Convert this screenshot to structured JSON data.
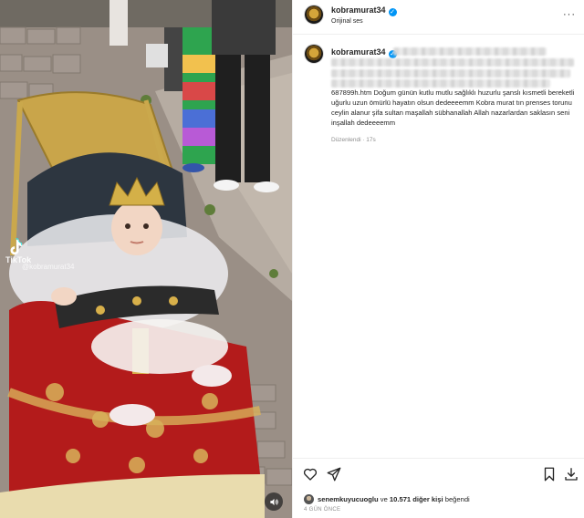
{
  "media": {
    "watermark_brand": "TikTok",
    "watermark_handle": "@kobramurat34",
    "sound_icon": "speaker-icon"
  },
  "header": {
    "username": "kobramurat34",
    "audio_label": "Orijinal ses",
    "more_icon": "more-icon",
    "verified": true
  },
  "comment": {
    "username": "kobramurat34",
    "caption": "687899h.htm Doğum günün kutlu mutlu sağlıklı huzurlu şanslı kısmetli bereketli uğurlu uzun ömürlü hayatın olsun dedeeeemm Kobra murat tın prenses torunu ceylin alanur şifa sultan maşallah sübhanallah Allah nazarlardan saklasın seni inşallah dedeeeemm",
    "edited_label": "Düzenlendi · 17s"
  },
  "actions": {
    "like_icon": "heart-icon",
    "comment_icon": "comment-icon",
    "share_icon": "share-icon",
    "save_icon": "bookmark-icon",
    "download_icon": "download-icon",
    "liked_by_user": "senemkuyucuoglu",
    "liked_by_mid": " ve ",
    "liked_by_count": "10.571 diğer kişi",
    "liked_by_suffix": " beğendi",
    "date": "4 GÜN ÖNCE"
  },
  "colors": {
    "verified_blue": "#0095f6",
    "text_primary": "#262626",
    "text_secondary": "#8e8e8e",
    "divider": "#efefef"
  }
}
